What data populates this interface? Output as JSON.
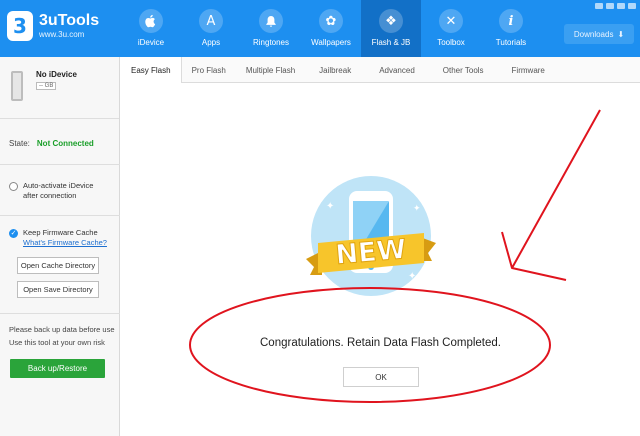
{
  "app": {
    "name": "3uTools",
    "url": "www.3u.com",
    "logo_glyph": "3"
  },
  "nav": [
    {
      "label": "iDevice",
      "icon": "apple-icon",
      "glyph": ""
    },
    {
      "label": "Apps",
      "icon": "appstore-icon",
      "glyph": "A"
    },
    {
      "label": "Ringtones",
      "icon": "bell-icon",
      "glyph": "🔔"
    },
    {
      "label": "Wallpapers",
      "icon": "flower-icon",
      "glyph": "✿"
    },
    {
      "label": "Flash & JB",
      "icon": "dropbox-icon",
      "glyph": "❖"
    },
    {
      "label": "Toolbox",
      "icon": "tools-icon",
      "glyph": "✕"
    },
    {
      "label": "Tutorials",
      "icon": "info-icon",
      "glyph": "i"
    }
  ],
  "downloads": {
    "label": "Downloads",
    "icon": "download-icon",
    "glyph": "⬇"
  },
  "device": {
    "name": "No iDevice",
    "capacity": "-- GB"
  },
  "state": {
    "label": "State:",
    "value": "Not Connected",
    "color": "#1a9f29"
  },
  "sidebar": {
    "auto_activate_line1": "Auto-activate iDevice",
    "auto_activate_line2": "after connection",
    "keep_cache": "Keep Firmware Cache",
    "whats_cache": "What's Firmware Cache?",
    "open_cache": "Open Cache Directory",
    "open_save": "Open Save Directory",
    "warning_line1": "Please back up data before use",
    "warning_line2": "Use this tool at your own risk",
    "backup_button": "Back up/Restore"
  },
  "tabs": [
    "Easy Flash",
    "Pro Flash",
    "Multiple Flash",
    "Jailbreak",
    "Advanced",
    "Other Tools",
    "Firmware"
  ],
  "dialog": {
    "badge": "NEW",
    "message": "Congratulations. Retain Data Flash Completed.",
    "ok_button": "OK"
  },
  "colors": {
    "accent": "#1d8ff0",
    "active_nav": "#1270c7",
    "annotation": "#e0141e",
    "ribbon": "#f7c52b"
  }
}
